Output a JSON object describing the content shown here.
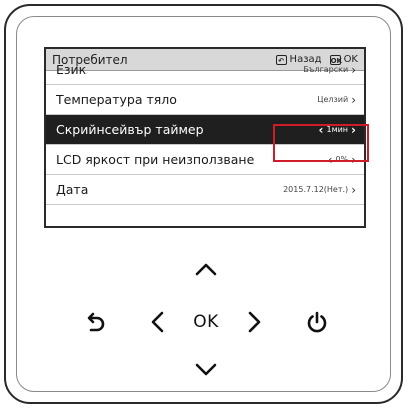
{
  "screen": {
    "title": "Потребител",
    "back_key": "Назад",
    "ok_key": "OK",
    "back_key_icon": "back-key-icon",
    "ok_key_icon": "ok-key-icon"
  },
  "menu": {
    "items": [
      {
        "label": "Език",
        "value": "Български"
      },
      {
        "label": "Температура тяло",
        "value": "Целзий"
      },
      {
        "label": "Скрийнсейвър таймер",
        "value": "1мин",
        "selected": true
      },
      {
        "label": "LCD яркост при неизползване",
        "value": "0%"
      },
      {
        "label": "Дата",
        "value": "2015.7.12(Нет.)"
      }
    ]
  },
  "controls": {
    "ok_label": "OK",
    "icons": [
      "up-arrow-icon",
      "down-arrow-icon",
      "left-arrow-icon",
      "right-arrow-icon",
      "back-arrow-icon",
      "power-icon"
    ]
  },
  "colors": {
    "highlight": "#d01c28",
    "selected_row": "#1f1f1f",
    "header_bg": "#d8d8d8"
  }
}
